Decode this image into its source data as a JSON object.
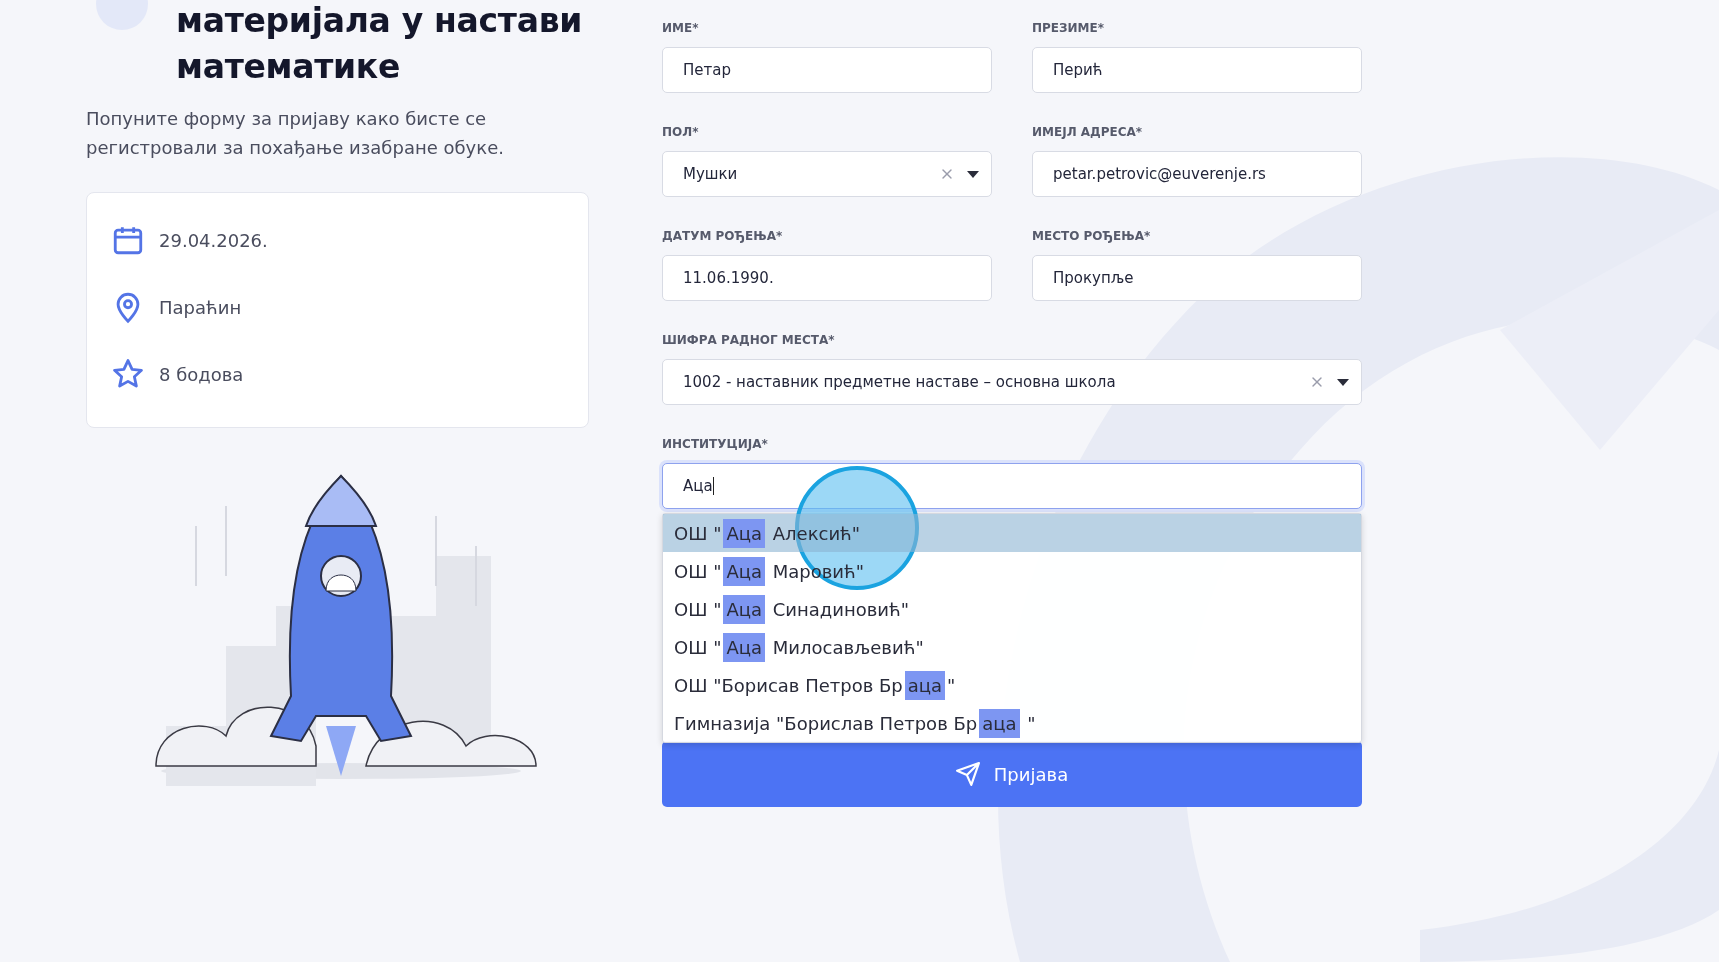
{
  "heading": {
    "title_lines": [
      "материјала у настави",
      "математике"
    ]
  },
  "intro": "Попуните форму за пријаву како бисте се регистровали за похађање изабране обуке.",
  "details": [
    {
      "kind": "date",
      "text": "29.04.2026."
    },
    {
      "kind": "location",
      "text": "Параћин"
    },
    {
      "kind": "points",
      "text": "8 бодова"
    }
  ],
  "form": {
    "rows": [
      [
        {
          "label": "ИМЕ*",
          "kind": "text",
          "value": "Петар"
        },
        {
          "label": "ПРЕЗИМЕ*",
          "kind": "text",
          "value": "Перић"
        }
      ],
      [
        {
          "label": "ПОЛ*",
          "kind": "select",
          "value": "Мушки"
        },
        {
          "label": "ИМЕЈЛ АДРЕСА*",
          "kind": "text",
          "value": "petar.petrovic@euverenje.rs"
        }
      ],
      [
        {
          "label": "ДАТУМ РОЂЕЊА*",
          "kind": "text",
          "value": "11.06.1990."
        },
        {
          "label": "МЕСТО РОЂЕЊА*",
          "kind": "text",
          "value": "Прокупље"
        }
      ],
      [
        {
          "label": "ШИФРА РАДНОГ МЕСТА*",
          "kind": "select",
          "value": "1002 - наставник предметне наставе – основна школа"
        }
      ],
      [
        {
          "label": "ИНСТИТУЦИЈА*",
          "kind": "search",
          "value": "Аца",
          "focused": true
        }
      ]
    ],
    "suggestions": [
      {
        "prefix": "ОШ \"",
        "match": "Аца",
        "suffix": " Алексић\"",
        "selected": true
      },
      {
        "prefix": "ОШ \"",
        "match": "Аца",
        "suffix": " Маровић\"",
        "selected": false
      },
      {
        "prefix": "ОШ \"",
        "match": "Аца",
        "suffix": " Синадиновић\"",
        "selected": false
      },
      {
        "prefix": "ОШ \"",
        "match": "Аца",
        "suffix": " Милосављевић\"",
        "selected": false
      },
      {
        "prefix": "ОШ \"Борисав Петров Бр",
        "match": "аца",
        "suffix": "\"",
        "selected": false
      },
      {
        "prefix": "Гимназија \"Борислав Петров Бр",
        "match": "аца",
        "suffix": " \"",
        "selected": false
      }
    ],
    "submit": "Пријава"
  }
}
